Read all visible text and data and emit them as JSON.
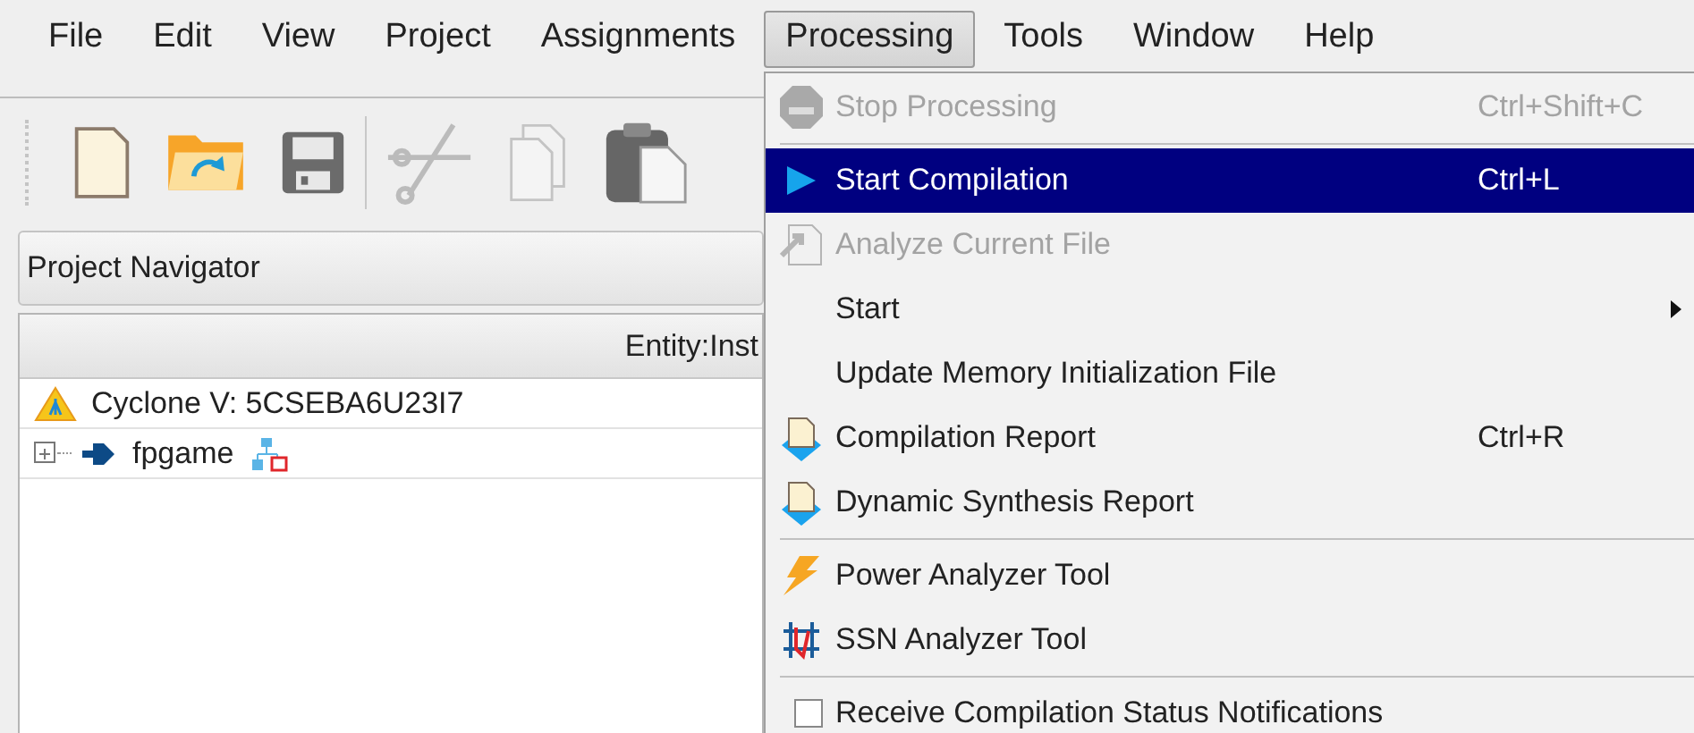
{
  "menu_bar": [
    {
      "label": "File",
      "selected": false
    },
    {
      "label": "Edit",
      "selected": false
    },
    {
      "label": "View",
      "selected": false
    },
    {
      "label": "Project",
      "selected": false
    },
    {
      "label": "Assignments",
      "selected": false
    },
    {
      "label": "Processing",
      "selected": true
    },
    {
      "label": "Tools",
      "selected": false
    },
    {
      "label": "Window",
      "selected": false
    },
    {
      "label": "Help",
      "selected": false
    }
  ],
  "toolbar": [
    {
      "disabled": false
    },
    {
      "disabled": false
    },
    {
      "disabled": false
    },
    {
      "disabled": true
    },
    {
      "disabled": true
    },
    {
      "disabled": false
    }
  ],
  "project_navigator": {
    "title": "Project Navigator",
    "columns": [
      "Entity:Inst"
    ],
    "tree": [
      {
        "kind": "device",
        "label": "Cyclone V: 5CSEBA6U23I7"
      },
      {
        "kind": "entity",
        "label": "fpgame",
        "expanded": false
      }
    ]
  },
  "processing_menu": {
    "items": [
      {
        "kind": "item",
        "label": "Stop Processing",
        "shortcut": "Ctrl+Shift+C",
        "disabled": true,
        "selected": false
      },
      {
        "kind": "separator"
      },
      {
        "kind": "item",
        "label": "Start Compilation",
        "shortcut": "Ctrl+L",
        "disabled": false,
        "selected": true
      },
      {
        "kind": "item",
        "label": "Analyze Current File",
        "disabled": true,
        "selected": false
      },
      {
        "kind": "submenu",
        "label": "Start",
        "disabled": false,
        "selected": false
      },
      {
        "kind": "item",
        "label": "Update Memory Initialization File",
        "disabled": false,
        "selected": false
      },
      {
        "kind": "item",
        "label": "Compilation Report",
        "shortcut": "Ctrl+R",
        "disabled": false,
        "selected": false
      },
      {
        "kind": "item",
        "label": "Dynamic Synthesis Report",
        "disabled": false,
        "selected": false
      },
      {
        "kind": "separator"
      },
      {
        "kind": "item",
        "label": "Power Analyzer Tool",
        "disabled": false,
        "selected": false
      },
      {
        "kind": "item",
        "label": "SSN Analyzer Tool",
        "disabled": false,
        "selected": false
      },
      {
        "kind": "separator"
      },
      {
        "kind": "checkbox",
        "label": "Receive Compilation Status Notifications",
        "checked": false,
        "disabled": false,
        "selected": false
      }
    ]
  }
}
